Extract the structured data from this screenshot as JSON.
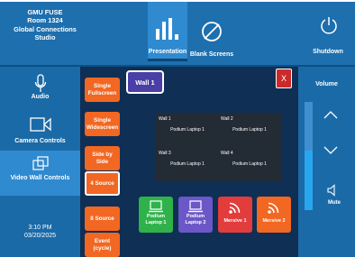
{
  "room": {
    "line1": "GMU FUSE",
    "line2": "Room 1324",
    "line3": "Global Connections",
    "line4": "Studio"
  },
  "tabs": [
    {
      "label": "Presentation",
      "icon": "bar-chart-icon",
      "active": true
    },
    {
      "label": "Blank Screens",
      "icon": "blank-screen-icon",
      "active": false
    }
  ],
  "shutdown": {
    "label": "Shutdown",
    "icon": "power-icon"
  },
  "sidebar": {
    "items": [
      {
        "label": "Audio",
        "icon": "microphone-icon"
      },
      {
        "label": "Camera Controls",
        "icon": "camera-icon"
      },
      {
        "label": "Video Wall Controls",
        "icon": "video-wall-icon",
        "active": true
      }
    ],
    "time": "3:10 PM",
    "date": "03/20/2025"
  },
  "layout_menu": [
    {
      "label": "Single Fullscreen"
    },
    {
      "label": "Single Widescreen"
    },
    {
      "label": "Side by Side"
    },
    {
      "label": "4 Source",
      "selected": true
    },
    {
      "label": "8 Source"
    },
    {
      "label": "Event (cycle)"
    }
  ],
  "wall": {
    "tab_label": "Wall 1",
    "close_label": "X"
  },
  "wall_grid": [
    {
      "name": "Wall 1",
      "source": "Podium Laptop 1"
    },
    {
      "name": "Wall 2",
      "source": "Podium Laptop 1"
    },
    {
      "name": "Wall 3",
      "source": "Podium Laptop 1"
    },
    {
      "name": "Wall 4",
      "source": "Podium Laptop 1"
    }
  ],
  "sources": [
    {
      "label1": "Podium",
      "label2": "Laptop 1",
      "color": "#2fb24a",
      "icon": "laptop-icon"
    },
    {
      "label1": "Podium",
      "label2": "Laptop 2",
      "color": "#6b57c7",
      "icon": "laptop-icon"
    },
    {
      "label1": "Mersive 1",
      "label2": "",
      "color": "#e23c3c",
      "icon": "wireless-cast-icon"
    },
    {
      "label1": "Mersive 2",
      "label2": "",
      "color": "#f26722",
      "icon": "wireless-cast-icon"
    }
  ],
  "volume": {
    "title": "Volume",
    "level_fraction": 0.55,
    "mute_label": "Mute"
  }
}
